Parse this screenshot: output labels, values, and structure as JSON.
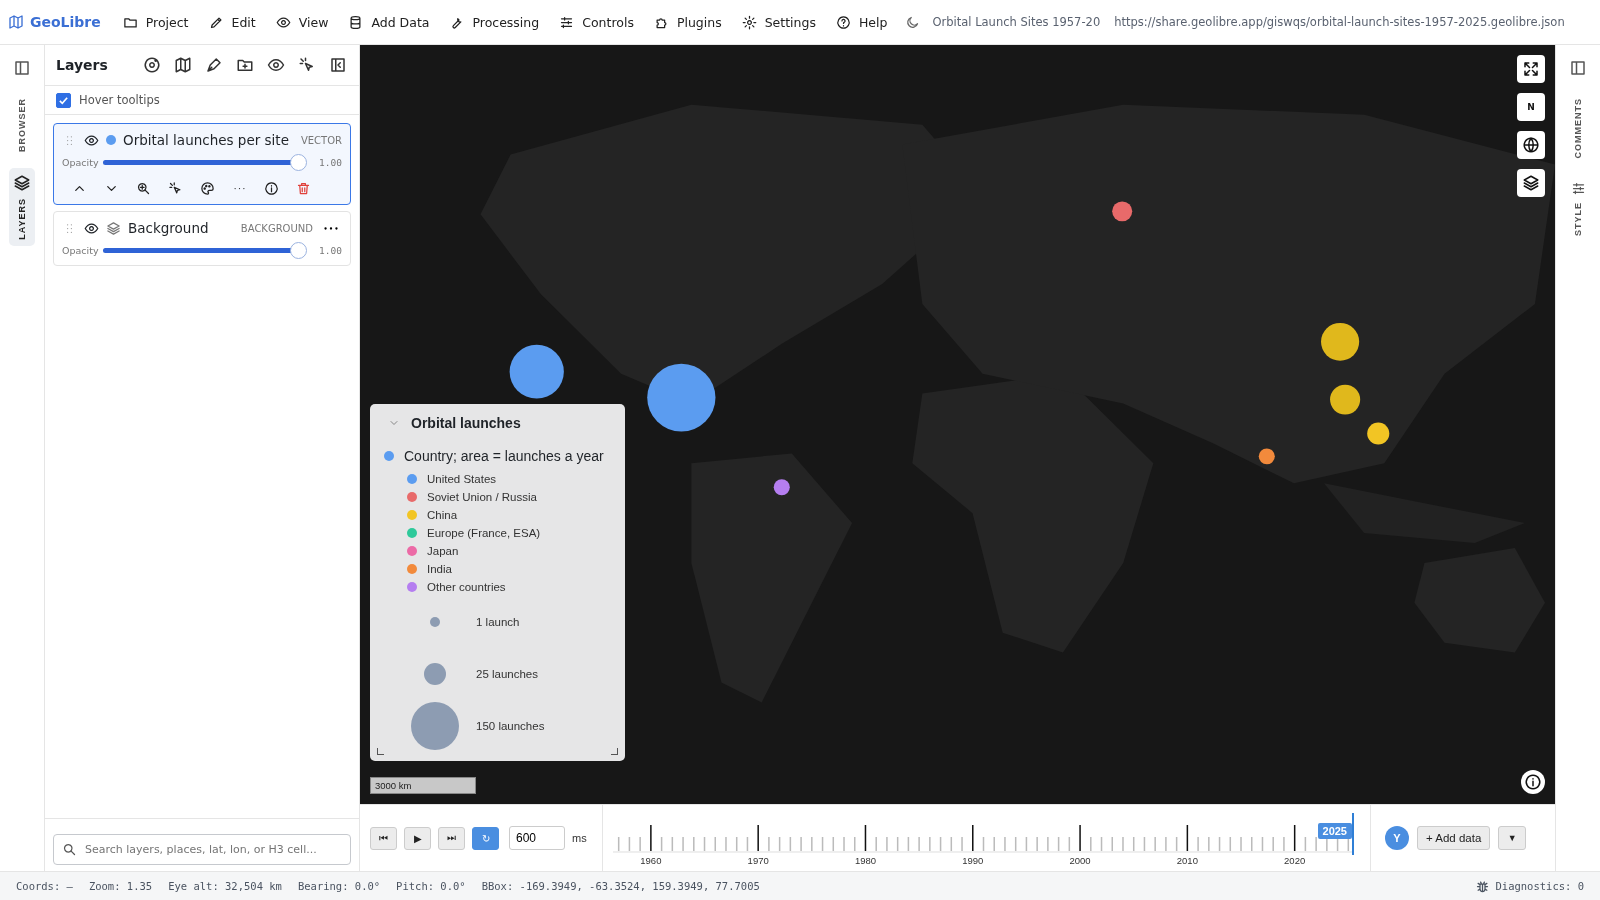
{
  "app": {
    "name": "GeoLibre"
  },
  "menu": [
    {
      "label": "Project"
    },
    {
      "label": "Edit"
    },
    {
      "label": "View"
    },
    {
      "label": "Add Data"
    },
    {
      "label": "Processing"
    },
    {
      "label": "Controls"
    },
    {
      "label": "Plugins"
    },
    {
      "label": "Settings"
    },
    {
      "label": "Help"
    }
  ],
  "project": {
    "title": "Orbital Launch Sites 1957-20",
    "url": "https://share.geolibre.app/giswqs/orbital-launch-sites-1957-2025.geolibre.json"
  },
  "left_rail": [
    {
      "label": "BROWSER",
      "selected": false
    },
    {
      "label": "LAYERS",
      "selected": true
    }
  ],
  "right_rail": [
    {
      "label": "COMMENTS"
    },
    {
      "label": "STYLE"
    }
  ],
  "layers_panel": {
    "title": "Layers",
    "hover_tooltips": {
      "label": "Hover tooltips",
      "checked": true
    },
    "layers": [
      {
        "name": "Orbital launches per site",
        "type": "VECTOR",
        "kind": "vector",
        "color": "#5b9cf0",
        "visible": true,
        "selected": true,
        "opacity_label": "Opacity",
        "level": 1,
        "reading": "1.00"
      },
      {
        "name": "Background",
        "type": "BACKGROUND",
        "kind": "background",
        "visible": true,
        "selected": false,
        "opacity_label": "Opacity",
        "level": 1,
        "reading": "1.00"
      }
    ],
    "search": {
      "placeholder": "Search layers, places, lat, lon, or H3 cell..."
    }
  },
  "map": {
    "compass": "N",
    "scale": "3000 km",
    "legend": {
      "title": "Orbital launches",
      "expanded": true,
      "field": {
        "label": "Country; area = launches a year",
        "color": "#5b9cf0"
      },
      "categories": [
        {
          "label": "United States",
          "color": "#5b9cf0"
        },
        {
          "label": "Soviet Union / Russia",
          "color": "#e86a6a"
        },
        {
          "label": "China",
          "color": "#f2c524"
        },
        {
          "label": "Europe (France, ESA)",
          "color": "#2ec99a"
        },
        {
          "label": "Japan",
          "color": "#ec6aa6"
        },
        {
          "label": "India",
          "color": "#f28a3c"
        },
        {
          "label": "Other countries",
          "color": "#b57ef0"
        }
      ],
      "sizes": [
        {
          "label": "1 launch"
        },
        {
          "label": "25 launches"
        },
        {
          "label": "150 launches"
        }
      ]
    }
  },
  "timeline": {
    "buttons": [
      {
        "label": "⏮",
        "on": false
      },
      {
        "label": "▶",
        "on": false
      },
      {
        "label": "⏭",
        "on": false
      },
      {
        "label": "↻",
        "on": true
      }
    ],
    "interval": "600",
    "unit": "ms",
    "years": [
      "1960",
      "1970",
      "1980",
      "1990",
      "2000",
      "2010",
      "2020"
    ],
    "current": "2025",
    "level": 1,
    "user": "Y",
    "add_data": "+ Add data",
    "dropdown": "▼"
  },
  "status_bar": {
    "items": [
      "Coords: —",
      "Zoom: 1.35",
      "Eye alt: 32,504 km",
      "Bearing: 0.0°",
      "Pitch: 0.0°",
      "BBox: -169.3949, -63.3524, 159.3949, 77.7005"
    ],
    "diagnostics": "Diagnostics: 0"
  }
}
